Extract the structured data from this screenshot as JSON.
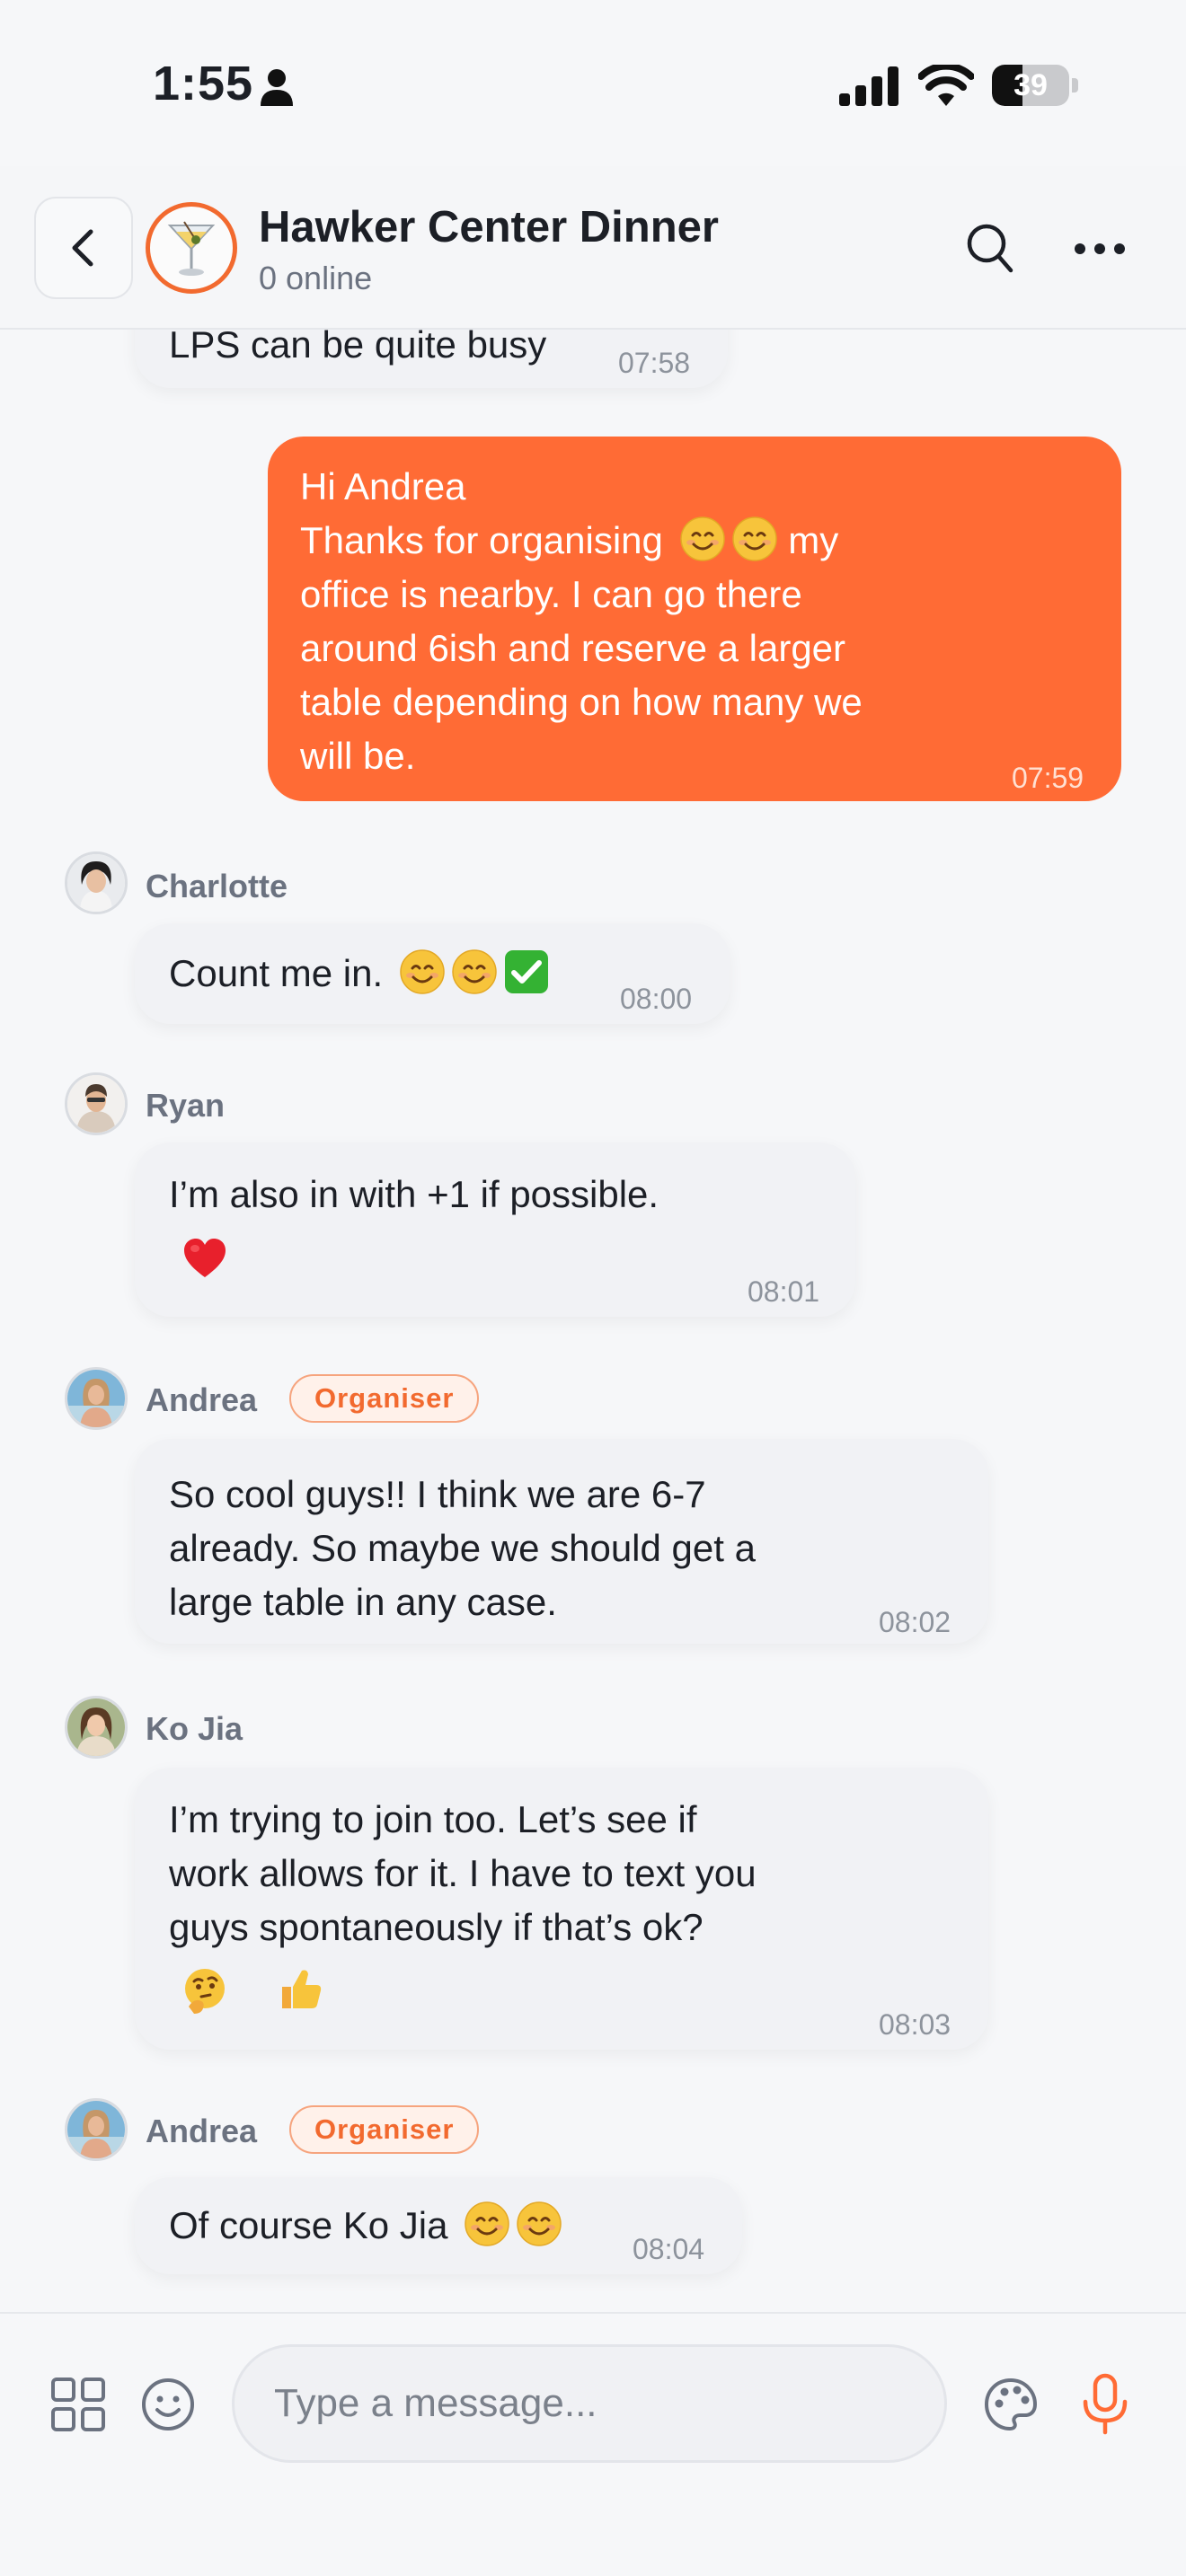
{
  "status_bar": {
    "time": "1:55",
    "battery": "39",
    "battery_level": 0.39
  },
  "header": {
    "title": "Hawker Center Dinner",
    "subtitle": "0 online"
  },
  "messages": [
    {
      "type": "incoming",
      "text": "LPS can be quite busy",
      "time": "07:58"
    },
    {
      "type": "outgoing",
      "text": "Hi Andrea\nThanks for organising",
      "text_after_emoji": "my\noffice is nearby. I can go there\naround 6ish and reserve a larger\ntable depending on how many we\nwill be.",
      "emoji": [
        "smiling-face",
        "smiling-face"
      ],
      "time": "07:59"
    },
    {
      "type": "incoming",
      "sender": "Charlotte",
      "text": "Count me in.",
      "emoji": [
        "smiling-face",
        "smiling-face",
        "check-mark"
      ],
      "time": "08:00"
    },
    {
      "type": "incoming",
      "sender": "Ryan",
      "text": "I’m also in with +1 if possible.",
      "reactions": [
        "red-heart"
      ],
      "time": "08:01"
    },
    {
      "type": "incoming",
      "sender": "Andrea",
      "badge": "Organiser",
      "text": "So cool guys!! I think we are 6-7\nalready. So maybe we should get a\nlarge table in any case.",
      "time": "08:02"
    },
    {
      "type": "incoming",
      "sender": "Ko Jia",
      "text": "I’m trying to join too. Let’s see if\nwork allows for it. I have to text you\nguys spontaneously if that’s ok?",
      "reactions": [
        "thinking-face",
        "thumbs-up"
      ],
      "time": "08:03"
    },
    {
      "type": "incoming",
      "sender": "Andrea",
      "badge": "Organiser",
      "text": "Of course Ko Jia",
      "emoji": [
        "smiling-face",
        "smiling-face"
      ],
      "time": "08:04"
    }
  ],
  "composer": {
    "placeholder": "Type a message..."
  },
  "colors": {
    "accent": "#ff6b35",
    "badge_text": "#f26a2f",
    "bubble_in": "#f1f2f5",
    "background": "#f6f7f9"
  }
}
